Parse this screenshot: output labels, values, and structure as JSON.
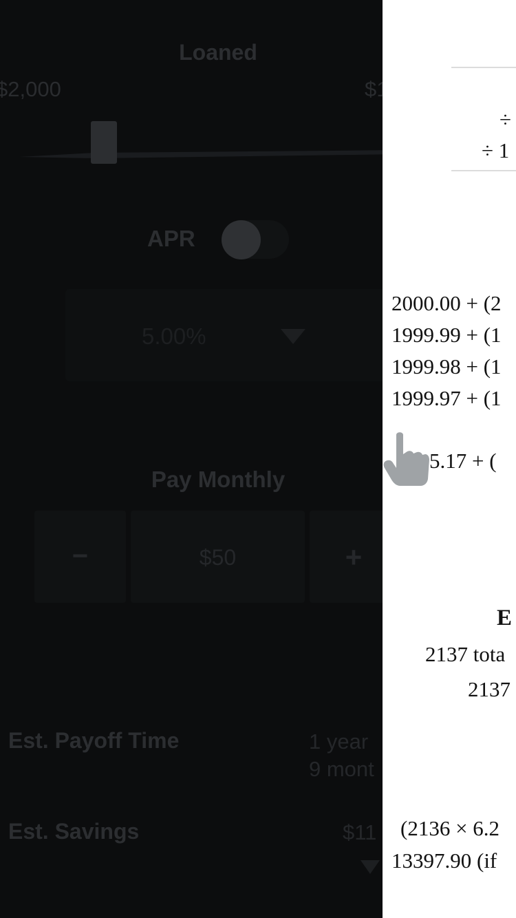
{
  "calculator": {
    "loaned_title": "Loaned",
    "loan_min": "$2,000",
    "loan_max": "$1",
    "apr_label": "APR",
    "apr_value": "5.00%",
    "pay_label": "Pay Monthly",
    "stepper_minus": "−",
    "stepper_value": "$50",
    "stepper_plus": "+",
    "payoff_label": "Est. Payoff Time",
    "payoff_line1": "1  year",
    "payoff_line2": "9  mont",
    "savings_label": "Est. Savings",
    "savings_value": "$11"
  },
  "math_panel": {
    "division_1": "÷",
    "division_2": "÷ 1",
    "eq_1": "2000.00 + (2",
    "eq_2": "1999.99 + (1",
    "eq_3": "1999.98 + (1",
    "eq_4": "1999.97 + (1",
    "eq_5": "5.17 + (",
    "heading": "E",
    "total_line": "2137 tota",
    "total_value": "2137",
    "calc_line_1": "(2136 × 6.2",
    "calc_line_2": "13397.90 (if"
  },
  "icons": {
    "pointer": "hand-pointer-icon",
    "dropdown": "caret-down-icon"
  },
  "colors": {
    "background": "#0c0d0e",
    "dim_text": "#2c2e31",
    "panel": "#ffffff",
    "pointer": "#9fa3a6"
  }
}
